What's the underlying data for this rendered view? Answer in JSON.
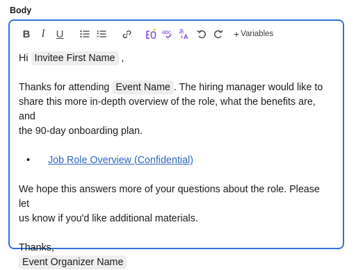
{
  "field": {
    "label": "Body"
  },
  "toolbar": {
    "bold": "B",
    "italic": "I",
    "underline": "U",
    "variables_plus": "+",
    "variables_label": "Variables"
  },
  "content": {
    "p1_prefix": "Hi",
    "chip_first_name": "Invitee First Name",
    "p1_suffix": ",",
    "p2_prefix": "Thanks for attending",
    "chip_event_name": "Event Name",
    "p2_line1_suffix": ". The hiring manager would like to",
    "p2_line2": "share this more in-depth overview of the role, what the benefits are, and",
    "p2_line3": "the 90-day onboarding plan.",
    "bullet_char": "•",
    "link_text": "Job Role Overview (Confidential) ",
    "p3_line1": "We hope this answers more of your questions about the role. Please let",
    "p3_line2": "us know if you'd like additional materials.",
    "closing": "Thanks,",
    "chip_organizer": "Event Organizer Name"
  },
  "colors": {
    "accent_border": "#2d72d9",
    "ai_icons": "#7b3fe4",
    "link": "#2d66c3",
    "chip_bg": "#eeeeee"
  },
  "icons": [
    "bold-icon",
    "italic-icon",
    "underline-icon",
    "bulleted-list-icon",
    "numbered-list-icon",
    "link-icon",
    "ai-assist-icon",
    "spellcheck-icon",
    "translate-icon",
    "undo-icon",
    "redo-icon"
  ]
}
